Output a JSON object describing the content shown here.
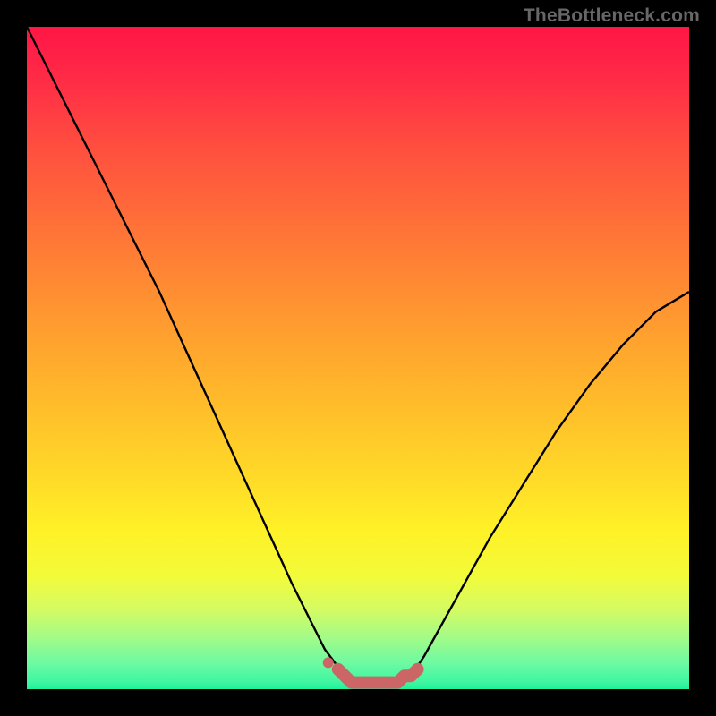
{
  "watermark": "TheBottleneck.com",
  "colors": {
    "page_bg": "#000000",
    "curve": "#000000",
    "marker": "#cc6666",
    "gradient_top": "#ff1744",
    "gradient_bottom": "#2bf4a1"
  },
  "chart_data": {
    "type": "line",
    "title": "",
    "xlabel": "",
    "ylabel": "",
    "xlim": [
      0,
      100
    ],
    "ylim": [
      0,
      100
    ],
    "grid": false,
    "series": [
      {
        "name": "bottleneck-curve",
        "x": [
          0,
          5,
          10,
          15,
          20,
          25,
          30,
          35,
          40,
          45,
          48,
          50,
          52,
          55,
          58,
          60,
          65,
          70,
          75,
          80,
          85,
          90,
          95,
          100
        ],
        "values": [
          100,
          90,
          80,
          70,
          60,
          49,
          38,
          27,
          16,
          6,
          2,
          1,
          1,
          1,
          2,
          5,
          14,
          23,
          31,
          39,
          46,
          52,
          57,
          60
        ]
      }
    ],
    "markers": {
      "name": "optimal-region",
      "x": [
        47,
        48,
        49,
        50,
        51,
        52,
        53,
        54,
        55,
        56,
        57,
        58,
        59
      ],
      "values": [
        3,
        2,
        1,
        1,
        1,
        1,
        1,
        1,
        1,
        1,
        2,
        2,
        3
      ]
    }
  }
}
